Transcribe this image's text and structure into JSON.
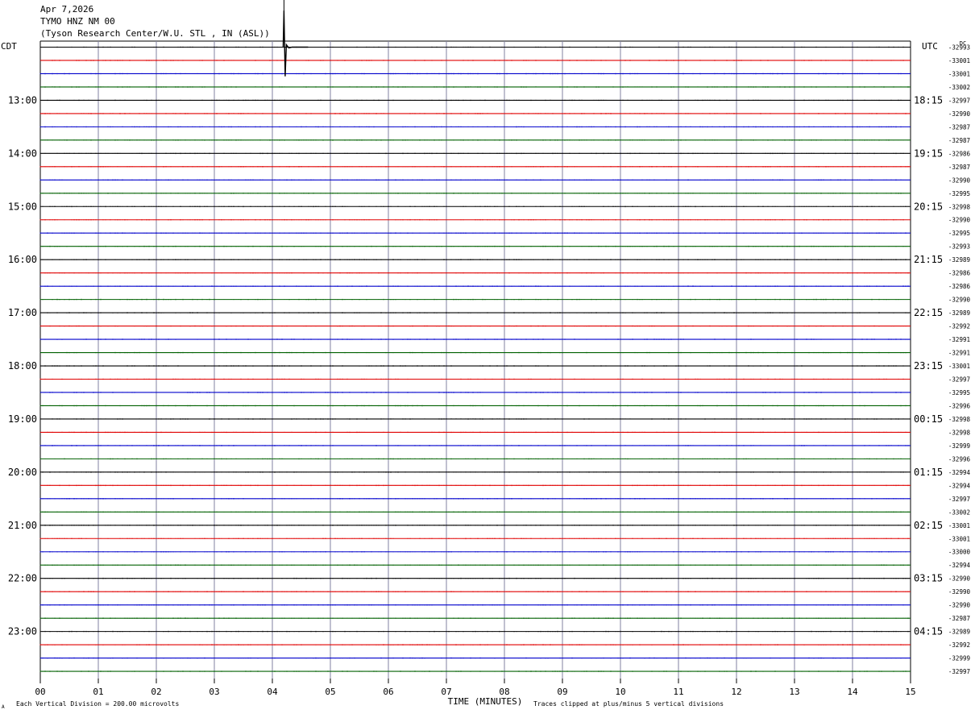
{
  "header": {
    "date": "Apr 7,2026",
    "station": "TYMO HNZ NM 00",
    "location": "(Tyson Research Center/W.U. STL , IN (ASL))"
  },
  "labels": {
    "left_zone": "CDT",
    "right_zone": "UTC",
    "dc": "DC",
    "footer_scale": "Each Vertical Division =  200.00 microvolts",
    "footer_clip": "Traces clipped at plus/minus 5 vertical divisions",
    "footer_mark": "A"
  },
  "chart_data": {
    "type": "line",
    "title": "",
    "xlabel": "TIME (MINUTES)",
    "ylabel": "",
    "xlim": [
      0,
      15
    ],
    "x_ticks": [
      "00",
      "01",
      "02",
      "03",
      "04",
      "05",
      "06",
      "07",
      "08",
      "09",
      "10",
      "11",
      "12",
      "13",
      "14",
      "15"
    ],
    "trace_colors": [
      "#000000",
      "#e00000",
      "#0000cc",
      "#006000"
    ],
    "grid": true,
    "left_time_labels": [
      "13:00",
      "14:00",
      "15:00",
      "16:00",
      "17:00",
      "18:00",
      "19:00",
      "20:00",
      "21:00",
      "22:00",
      "23:00"
    ],
    "right_time_labels": [
      "18:15",
      "19:15",
      "20:15",
      "21:15",
      "22:15",
      "23:15",
      "00:15",
      "01:15",
      "02:15",
      "03:15",
      "04:15"
    ],
    "dc_offsets": [
      "-32993",
      "-33001",
      "-33001",
      "-33002",
      "-32997",
      "-32990",
      "-32987",
      "-32987",
      "-32986",
      "-32987",
      "-32990",
      "-32995",
      "-32998",
      "-32990",
      "-32995",
      "-32993",
      "-32989",
      "-32986",
      "-32986",
      "-32990",
      "-32989",
      "-32992",
      "-32991",
      "-32991",
      "-33001",
      "-32997",
      "-32995",
      "-32996",
      "-32998",
      "-32998",
      "-32999",
      "-32996",
      "-32994",
      "-32994",
      "-32997",
      "-33002",
      "-33001",
      "-33001",
      "-33000",
      "-32994",
      "-32990",
      "-32990",
      "-32990",
      "-32987",
      "-32989",
      "-32992",
      "-32999",
      "-32997"
    ],
    "events": [
      {
        "trace": 0,
        "minute": 4.2,
        "amplitude_divisions": 5,
        "clipped": true
      }
    ]
  }
}
